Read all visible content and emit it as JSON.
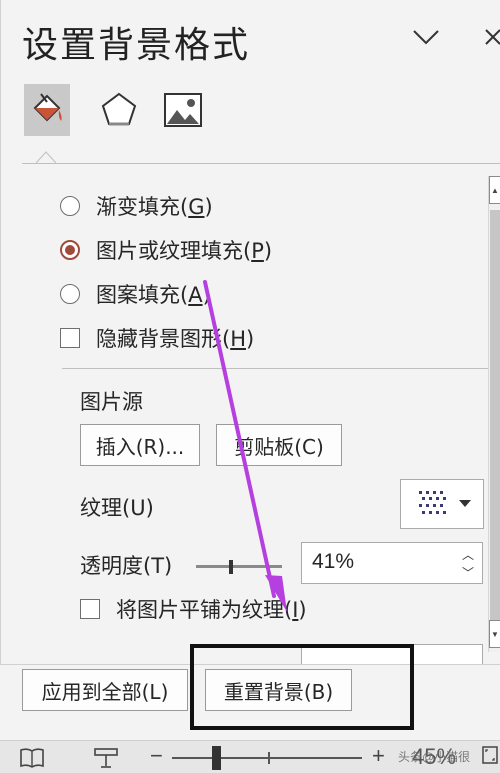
{
  "pane": {
    "title": "设置背景格式",
    "categories": [
      {
        "id": "fill",
        "icon": "paint-bucket-icon",
        "active": true
      },
      {
        "id": "effects",
        "icon": "pentagon-icon",
        "active": false
      },
      {
        "id": "picture",
        "icon": "picture-icon",
        "active": false
      }
    ]
  },
  "fill_options": {
    "gradient": {
      "text": "渐变填充(",
      "key": "G",
      "tail": ")",
      "checked": false
    },
    "picture_texture": {
      "text": "图片或纹理填充(",
      "key": "P",
      "tail": ")",
      "checked": true
    },
    "pattern": {
      "text": "图案填充(",
      "key": "A",
      "tail": ")",
      "checked": false
    },
    "hide_graphics": {
      "text": "隐藏背景图形(",
      "key": "H",
      "tail": ")",
      "checked": false
    }
  },
  "picture_source": {
    "label": "图片源",
    "insert_label": "插入(R)...",
    "clipboard_label": "剪贴板(C)"
  },
  "texture": {
    "label": "纹理(U)"
  },
  "transparency": {
    "label": "透明度(T)",
    "value": "41%",
    "fraction": 0.41
  },
  "tile": {
    "text": "将图片平铺为纹理(",
    "key": "I",
    "tail": ")",
    "checked": false
  },
  "footer": {
    "apply_all_label": "应用到全部(L)",
    "reset_label": "重置背景(B)"
  },
  "status": {
    "zoom_minus": "−",
    "zoom_plus": "+",
    "zoom_level": "45%",
    "zoom_fraction": 0.45,
    "watermark": "头条@小猫很"
  },
  "colors": {
    "accent_radio": "#a04a3b",
    "annotation_arrow": "#b63fe0",
    "active_category": "#c9c9c9"
  }
}
